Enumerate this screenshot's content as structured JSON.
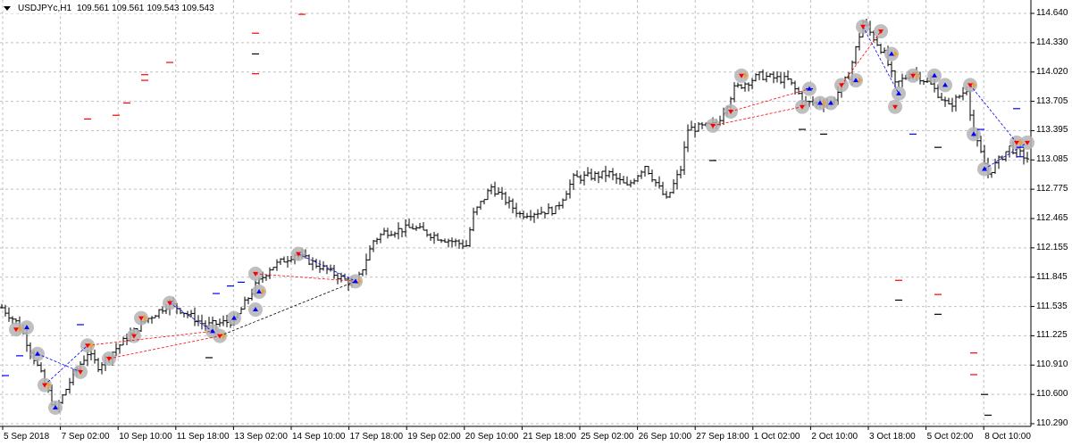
{
  "chart_data": {
    "type": "ohlc",
    "title": "USDJPYc,H1",
    "quote": [
      "109.561",
      "109.561",
      "109.543",
      "109.543"
    ],
    "ylim": [
      110.29,
      114.64
    ],
    "y_ticks": [
      "114.640",
      "114.330",
      "114.020",
      "113.705",
      "113.395",
      "113.085",
      "112.775",
      "112.465",
      "112.155",
      "111.845",
      "111.535",
      "111.225",
      "110.910",
      "110.600",
      "110.290"
    ],
    "x_ticks": [
      "5 Sep 2018",
      "7 Sep 02:00",
      "10 Sep 10:00",
      "11 Sep 18:00",
      "13 Sep 02:00",
      "14 Sep 10:00",
      "17 Sep 18:00",
      "19 Sep 02:00",
      "20 Sep 10:00",
      "21 Sep 18:00",
      "25 Sep 02:00",
      "26 Sep 10:00",
      "27 Sep 18:00",
      "1 Oct 02:00",
      "2 Oct 10:00",
      "3 Oct 18:00",
      "5 Oct 02:00",
      "8 Oct 10:00"
    ],
    "bars_count": 288,
    "price_path": [
      [
        0,
        111.52
      ],
      [
        5,
        111.33
      ],
      [
        11,
        110.81
      ],
      [
        15,
        110.43
      ],
      [
        20,
        110.81
      ],
      [
        24,
        111.04
      ],
      [
        27,
        110.9
      ],
      [
        32,
        111.09
      ],
      [
        40,
        111.38
      ],
      [
        47,
        111.57
      ],
      [
        57,
        111.33
      ],
      [
        65,
        111.38
      ],
      [
        71,
        111.75
      ],
      [
        75,
        111.94
      ],
      [
        82,
        112.09
      ],
      [
        90,
        111.94
      ],
      [
        99,
        111.75
      ],
      [
        104,
        112.23
      ],
      [
        107,
        112.32
      ],
      [
        115,
        112.37
      ],
      [
        122,
        112.27
      ],
      [
        130,
        112.18
      ],
      [
        132,
        112.51
      ],
      [
        137,
        112.8
      ],
      [
        145,
        112.51
      ],
      [
        155,
        112.56
      ],
      [
        160,
        112.89
      ],
      [
        170,
        112.94
      ],
      [
        175,
        112.8
      ],
      [
        180,
        113.03
      ],
      [
        186,
        112.66
      ],
      [
        190,
        112.99
      ],
      [
        192,
        113.41
      ],
      [
        200,
        113.46
      ],
      [
        205,
        113.84
      ],
      [
        212,
        113.98
      ],
      [
        220,
        113.93
      ],
      [
        225,
        113.69
      ],
      [
        232,
        113.69
      ],
      [
        237,
        113.98
      ],
      [
        241,
        114.55
      ],
      [
        247,
        114.21
      ],
      [
        250,
        113.88
      ],
      [
        255,
        114.02
      ],
      [
        260,
        113.88
      ],
      [
        265,
        113.65
      ],
      [
        270,
        113.84
      ],
      [
        272,
        113.36
      ],
      [
        276,
        112.94
      ],
      [
        282,
        113.22
      ],
      [
        288,
        113.08
      ]
    ],
    "signal_levels": [
      {
        "bar": 24,
        "price": 113.52,
        "color": "#ff0000"
      },
      {
        "bar": 32,
        "price": 113.56,
        "color": "#ff0000"
      },
      {
        "bar": 35,
        "price": 113.69,
        "color": "#ff0000"
      },
      {
        "bar": 40,
        "price": 113.93,
        "color": "#ff0000"
      },
      {
        "bar": 40,
        "price": 113.99,
        "color": "#ff0000"
      },
      {
        "bar": 47,
        "price": 114.12,
        "color": "#ff0000"
      },
      {
        "bar": 71,
        "price": 114.43,
        "color": "#ff0000"
      },
      {
        "bar": 71,
        "price": 114.21,
        "color": "#000000"
      },
      {
        "bar": 71,
        "price": 114.0,
        "color": "#ff0000"
      },
      {
        "bar": 84,
        "price": 114.63,
        "color": "#ff0000"
      },
      {
        "bar": 251,
        "price": 111.81,
        "color": "#ff0000"
      },
      {
        "bar": 251,
        "price": 111.6,
        "color": "#000000"
      },
      {
        "bar": 262,
        "price": 111.66,
        "color": "#ff0000"
      },
      {
        "bar": 262,
        "price": 111.45,
        "color": "#000000"
      },
      {
        "bar": 272,
        "price": 111.04,
        "color": "#ff0000"
      },
      {
        "bar": 272,
        "price": 110.81,
        "color": "#ff0000"
      },
      {
        "bar": 275,
        "price": 110.6,
        "color": "#000000"
      },
      {
        "bar": 276,
        "price": 110.38,
        "color": "#000000"
      },
      {
        "bar": 1,
        "price": 110.8,
        "color": "#0000ff"
      },
      {
        "bar": 5,
        "price": 111.01,
        "color": "#0000ff"
      },
      {
        "bar": 22,
        "price": 111.34,
        "color": "#0000ff"
      },
      {
        "bar": 60,
        "price": 111.67,
        "color": "#0000ff"
      },
      {
        "bar": 64,
        "price": 111.75,
        "color": "#0000ff"
      },
      {
        "bar": 67,
        "price": 111.79,
        "color": "#0000ff"
      },
      {
        "bar": 226,
        "price": 113.84,
        "color": "#0000ff"
      },
      {
        "bar": 274,
        "price": 113.41,
        "color": "#0000ff"
      },
      {
        "bar": 284,
        "price": 113.63,
        "color": "#0000ff"
      },
      {
        "bar": 285,
        "price": 113.22,
        "color": "#0000ff"
      },
      {
        "bar": 285,
        "price": 113.12,
        "color": "#0000ff"
      },
      {
        "bar": 255,
        "price": 113.36,
        "color": "#0000ff"
      },
      {
        "bar": 224,
        "price": 113.41,
        "color": "#000000"
      },
      {
        "bar": 230,
        "price": 113.36,
        "color": "#000000"
      },
      {
        "bar": 262,
        "price": 113.22,
        "color": "#000000"
      },
      {
        "bar": 199,
        "price": 113.08,
        "color": "#000000"
      },
      {
        "bar": 58,
        "price": 110.99,
        "color": "#000000"
      }
    ],
    "signal_points": [
      {
        "bar": 4,
        "price": 111.29,
        "arrow": "down"
      },
      {
        "bar": 7,
        "price": 111.31,
        "arrow": "up"
      },
      {
        "bar": 10,
        "price": 111.03,
        "arrow": "up"
      },
      {
        "bar": 12,
        "price": 110.7,
        "arrow": "down"
      },
      {
        "bar": 15,
        "price": 110.46,
        "arrow": "up"
      },
      {
        "bar": 22,
        "price": 110.84,
        "arrow": "down"
      },
      {
        "bar": 24,
        "price": 111.12,
        "arrow": "down"
      },
      {
        "bar": 30,
        "price": 110.98,
        "arrow": "down"
      },
      {
        "bar": 37,
        "price": 111.22,
        "arrow": "down"
      },
      {
        "bar": 39,
        "price": 111.41,
        "arrow": "down"
      },
      {
        "bar": 47,
        "price": 111.57,
        "arrow": "down"
      },
      {
        "bar": 59,
        "price": 111.27,
        "arrow": "up"
      },
      {
        "bar": 61,
        "price": 111.22,
        "arrow": "down"
      },
      {
        "bar": 65,
        "price": 111.41,
        "arrow": "up"
      },
      {
        "bar": 71,
        "price": 111.88,
        "arrow": "down"
      },
      {
        "bar": 72,
        "price": 111.69,
        "arrow": "up"
      },
      {
        "bar": 71,
        "price": 111.5,
        "arrow": "up"
      },
      {
        "bar": 83,
        "price": 112.09,
        "arrow": "down"
      },
      {
        "bar": 99,
        "price": 111.8,
        "arrow": "up"
      },
      {
        "bar": 199,
        "price": 113.45,
        "arrow": "down"
      },
      {
        "bar": 204,
        "price": 113.6,
        "arrow": "down"
      },
      {
        "bar": 207,
        "price": 113.98,
        "arrow": "down"
      },
      {
        "bar": 226,
        "price": 113.84,
        "arrow": "up"
      },
      {
        "bar": 224,
        "price": 113.65,
        "arrow": "down"
      },
      {
        "bar": 229,
        "price": 113.69,
        "arrow": "up"
      },
      {
        "bar": 232,
        "price": 113.69,
        "arrow": "up"
      },
      {
        "bar": 235,
        "price": 113.88,
        "arrow": "down"
      },
      {
        "bar": 239,
        "price": 113.93,
        "arrow": "up"
      },
      {
        "bar": 241,
        "price": 114.5,
        "arrow": "down"
      },
      {
        "bar": 246,
        "price": 114.45,
        "arrow": "down"
      },
      {
        "bar": 249,
        "price": 114.21,
        "arrow": "up"
      },
      {
        "bar": 251,
        "price": 113.79,
        "arrow": "up"
      },
      {
        "bar": 250,
        "price": 113.65,
        "arrow": "down"
      },
      {
        "bar": 255,
        "price": 113.98,
        "arrow": "down"
      },
      {
        "bar": 261,
        "price": 113.98,
        "arrow": "up"
      },
      {
        "bar": 264,
        "price": 113.88,
        "arrow": "up"
      },
      {
        "bar": 271,
        "price": 113.88,
        "arrow": "down"
      },
      {
        "bar": 272,
        "price": 113.36,
        "arrow": "up"
      },
      {
        "bar": 275,
        "price": 112.99,
        "arrow": "up"
      },
      {
        "bar": 284,
        "price": 113.27,
        "arrow": "down"
      },
      {
        "bar": 287,
        "price": 113.27,
        "arrow": "down"
      }
    ],
    "links": [
      {
        "from": [
          10,
          111.03
        ],
        "to": [
          22,
          110.84
        ],
        "color": "#0000ff"
      },
      {
        "from": [
          12,
          110.7
        ],
        "to": [
          24,
          111.12
        ],
        "color": "#0000ff"
      },
      {
        "from": [
          24,
          111.12
        ],
        "to": [
          59,
          111.27
        ],
        "color": "#ff0000"
      },
      {
        "from": [
          30,
          110.98
        ],
        "to": [
          61,
          111.22
        ],
        "color": "#ff0000"
      },
      {
        "from": [
          47,
          111.57
        ],
        "to": [
          59,
          111.27
        ],
        "color": "#0000ff"
      },
      {
        "from": [
          61,
          111.22
        ],
        "to": [
          99,
          111.8
        ],
        "color": "#000000"
      },
      {
        "from": [
          71,
          111.88
        ],
        "to": [
          99,
          111.8
        ],
        "color": "#ff0000"
      },
      {
        "from": [
          83,
          112.09
        ],
        "to": [
          99,
          111.8
        ],
        "color": "#0000ff"
      },
      {
        "from": [
          204,
          113.6
        ],
        "to": [
          226,
          113.84
        ],
        "color": "#ff0000"
      },
      {
        "from": [
          199,
          113.45
        ],
        "to": [
          224,
          113.65
        ],
        "color": "#ff0000"
      },
      {
        "from": [
          241,
          114.5
        ],
        "to": [
          251,
          113.79
        ],
        "color": "#0000ff"
      },
      {
        "from": [
          235,
          113.88
        ],
        "to": [
          246,
          114.45
        ],
        "color": "#ff0000"
      },
      {
        "from": [
          271,
          113.88
        ],
        "to": [
          284,
          113.27
        ],
        "color": "#0000ff"
      },
      {
        "from": [
          275,
          112.99
        ],
        "to": [
          287,
          113.27
        ],
        "color": "#0000ff"
      }
    ]
  }
}
